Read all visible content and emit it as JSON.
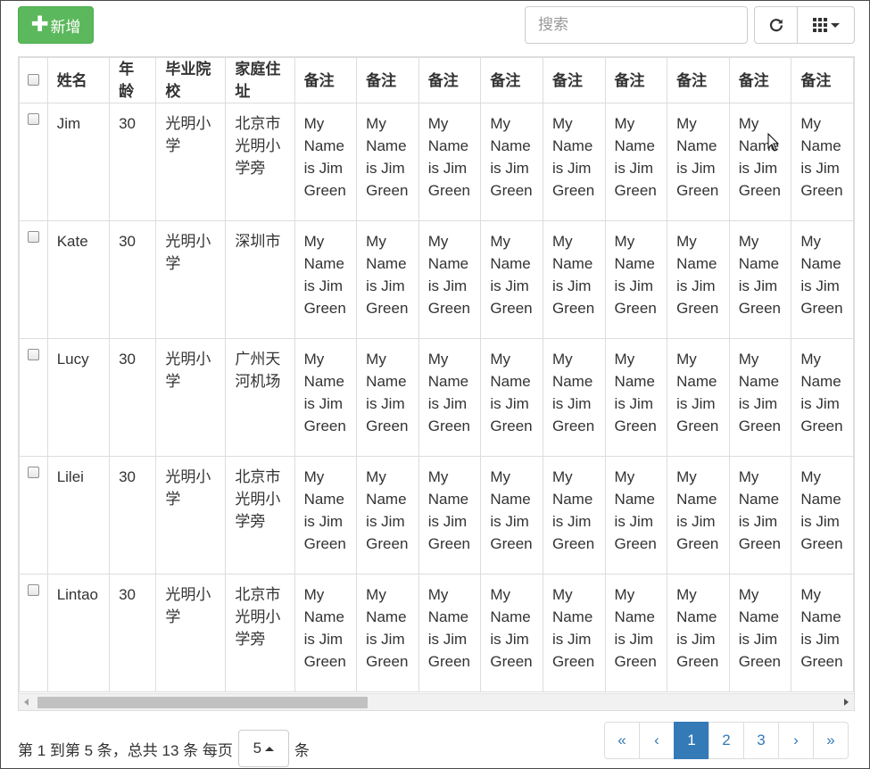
{
  "toolbar": {
    "add_label": "新增",
    "search_placeholder": "搜索",
    "search_value": ""
  },
  "table": {
    "columns": [
      "姓名",
      "年龄",
      "毕业院校",
      "家庭住址",
      "备注",
      "备注",
      "备注",
      "备注",
      "备注",
      "备注",
      "备注",
      "备注",
      "备注"
    ],
    "rows": [
      {
        "name": "Jim",
        "age": "30",
        "school": "光明小学",
        "address": "北京市光明小学旁"
      },
      {
        "name": "Kate",
        "age": "30",
        "school": "光明小学",
        "address": "深圳市"
      },
      {
        "name": "Lucy",
        "age": "30",
        "school": "光明小学",
        "address": "广州天河机场"
      },
      {
        "name": "Lilei",
        "age": "30",
        "school": "光明小学",
        "address": "北京市光明小学旁"
      },
      {
        "name": "Lintao",
        "age": "30",
        "school": "光明小学",
        "address": "北京市光明小学旁"
      }
    ],
    "remark": "My Name is Jim Green"
  },
  "footer": {
    "info_prefix": "第 1 到第 5 条，总共 13 条 每页",
    "page_size": "5",
    "info_suffix": "条"
  },
  "pagination": {
    "first": "«",
    "prev": "‹",
    "pages": [
      "1",
      "2",
      "3"
    ],
    "active_page": "1",
    "next": "›",
    "last": "»"
  },
  "colors": {
    "add_button": "#5cb85c",
    "active_page": "#337ab7",
    "link": "#337ab7"
  }
}
